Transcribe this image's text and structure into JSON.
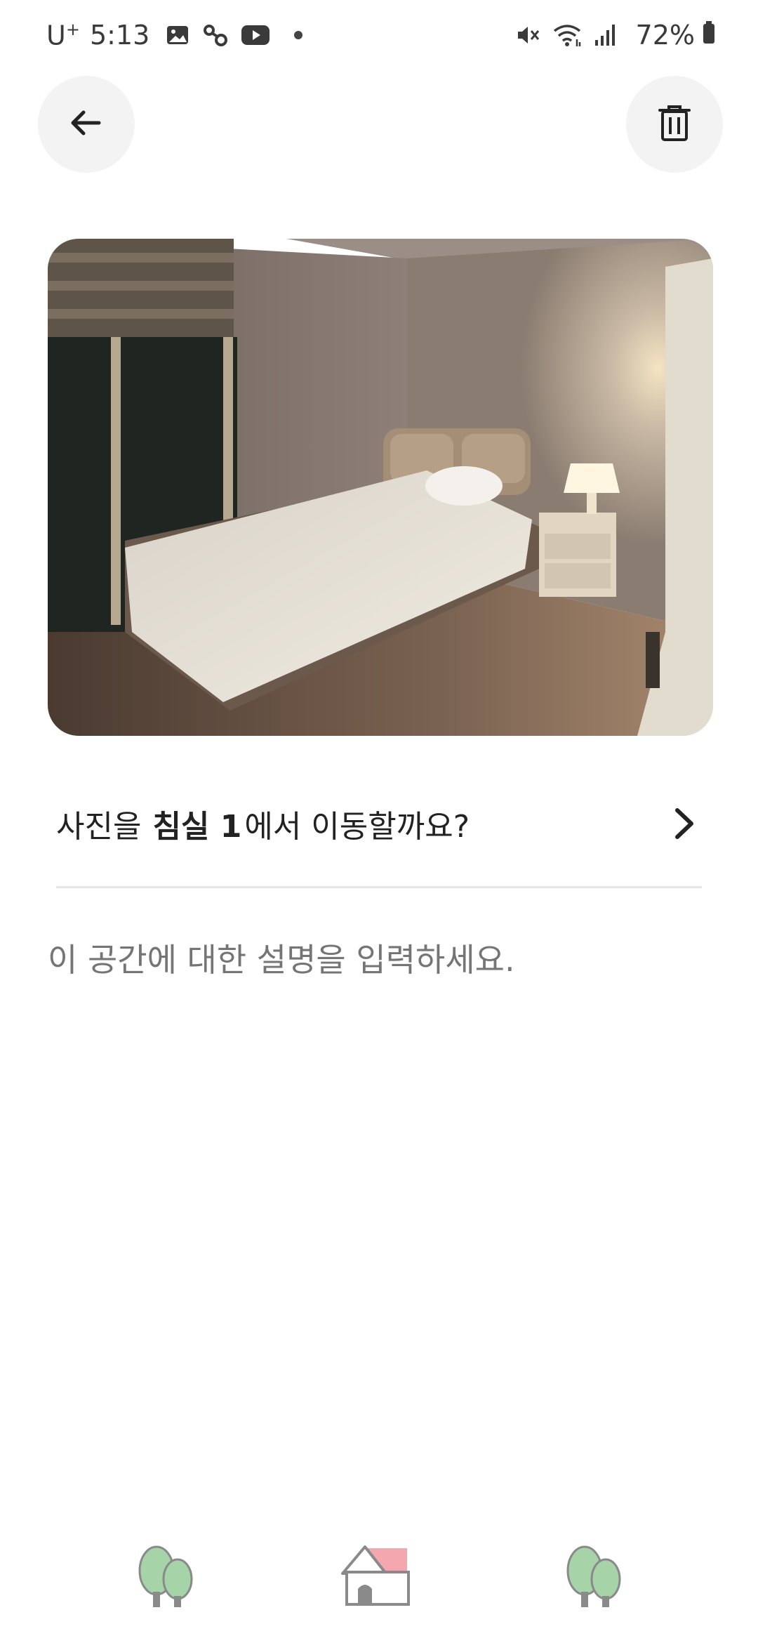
{
  "status_bar": {
    "carrier": "U",
    "carrier_sup": "+",
    "time": "5:13",
    "battery_percent": "72%",
    "icons": [
      "gallery-icon",
      "link-icon",
      "youtube-icon",
      "notification-dot",
      "mute-icon",
      "wifi-icon",
      "signal-icon",
      "battery-icon"
    ]
  },
  "toolbar": {
    "back_icon": "arrow-left-icon",
    "delete_icon": "trash-icon"
  },
  "photo": {
    "subject": "bedroom-photo"
  },
  "move_prompt": {
    "prefix": "사진을",
    "room_name": "침실 1",
    "suffix": "에서 이동할까요?",
    "chevron_icon": "chevron-right-icon"
  },
  "description": {
    "placeholder": "이 공간에 대한 설명을 입력하세요."
  },
  "bottom_nav": {
    "items": [
      {
        "icon": "tree-icon"
      },
      {
        "icon": "house-icon"
      },
      {
        "icon": "tree-icon"
      }
    ]
  },
  "colors": {
    "button_bg": "#f3f3f3",
    "divider": "#e6e6e6",
    "placeholder_text": "#7a7a7a",
    "tree_green": "#a6d3a8",
    "tree_trunk": "#8a8a8a",
    "roof_pink": "#f4a7ae"
  }
}
